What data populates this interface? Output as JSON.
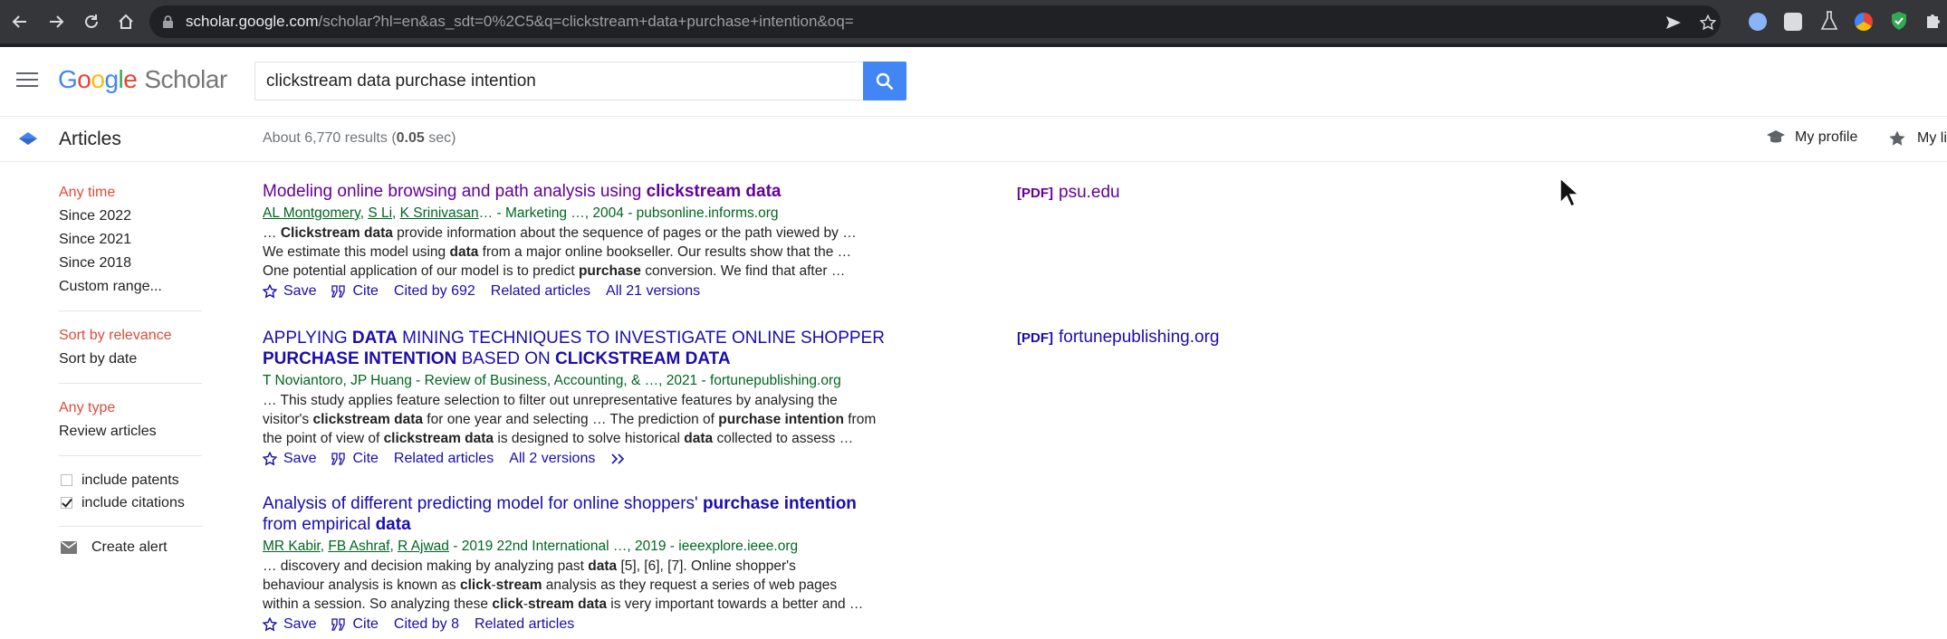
{
  "browser": {
    "url_host": "scholar.google.com",
    "url_path": "/scholar?hl=en&as_sdt=0%2C5&q=clickstream+data+purchase+intention&oq="
  },
  "header": {
    "logo_google": "Google",
    "logo_scholar": "Scholar",
    "search_value": "clickstream data purchase intention"
  },
  "subheader": {
    "articles_label": "Articles",
    "results_prefix": "About 6,770 results (",
    "results_time": "0.05",
    "results_suffix": " sec)",
    "my_profile": "My profile",
    "my_library": "My library"
  },
  "sidebar": {
    "time_filters": [
      "Any time",
      "Since 2022",
      "Since 2021",
      "Since 2018",
      "Custom range..."
    ],
    "sort_options": [
      "Sort by relevance",
      "Sort by date"
    ],
    "type_options": [
      "Any type",
      "Review articles"
    ],
    "include_patents": "include patents",
    "include_citations": "include citations",
    "create_alert": "Create alert"
  },
  "results": [
    {
      "title_a": "Modeling online browsing and path analysis using ",
      "title_b": "clickstream data",
      "authors": [
        "AL Montgomery",
        "S Li",
        "K Srinivasan"
      ],
      "source": "… - Marketing …, 2004 - pubsonline.informs.org",
      "snippet": [
        [
          "… ",
          "Clickstream data",
          " provide information about the sequence of pages or the path viewed by …"
        ],
        [
          "We estimate this model using ",
          "data",
          " from a major online bookseller. Our results show that the …"
        ],
        [
          "One potential application of our model is to predict ",
          "purchase",
          " conversion. We find that after …"
        ]
      ],
      "actions": [
        "Save",
        "Cite",
        "Cited by 692",
        "Related articles",
        "All 21 versions"
      ],
      "pdf_tag": "[PDF]",
      "pdf_host": "psu.edu"
    },
    {
      "title_parts": [
        "APPLYING ",
        "DATA",
        " MINING TECHNIQUES TO INVESTIGATE ONLINE SHOPPER ",
        "PURCHASE INTENTION",
        " BASED ON ",
        "CLICKSTREAM DATA"
      ],
      "authors_line": "T Noviantoro, JP Huang - Review of Business, Accounting, & …, 2021 - fortunepublishing.org",
      "snippet": [
        [
          "… This study applies feature selection to filter out unrepresentative features by analysing the ",
          "",
          ""
        ],
        [
          "visitor's ",
          "clickstream data",
          " for one year and selecting … The prediction of "
        ],
        [
          "the point of view of ",
          "clickstream data",
          " is designed to solve historical "
        ]
      ],
      "snippet_bold_extra": [
        "purchase intention",
        "data"
      ],
      "snippet_tail": [
        " from",
        " collected to assess …"
      ],
      "actions": [
        "Save",
        "Cite",
        "Related articles",
        "All 2 versions"
      ],
      "pdf_tag": "[PDF]",
      "pdf_host": "fortunepublishing.org"
    },
    {
      "title_a": "Analysis of different predicting model for online shoppers' ",
      "title_b": "purchase intention",
      "title_c": "from empirical ",
      "title_d": "data",
      "authors": [
        "MR Kabir",
        "FB Ashraf",
        "R Ajwad"
      ],
      "source": " - 2019 22nd International …, 2019 - ieeexplore.ieee.org",
      "snippet_line1": [
        "… discovery and decision making by analyzing past ",
        "data",
        " [5], [6], [7]. Online shopper's"
      ],
      "snippet_line2": [
        "behaviour analysis is known as ",
        "click",
        "-",
        "stream",
        " analysis as they request a series of web pages"
      ],
      "snippet_line3": [
        "within a session. So analyzing these ",
        "click",
        "-",
        "stream data",
        " is very important towards a better and …"
      ],
      "actions": [
        "Save",
        "Cite",
        "Cited by 8",
        "Related articles"
      ]
    }
  ]
}
